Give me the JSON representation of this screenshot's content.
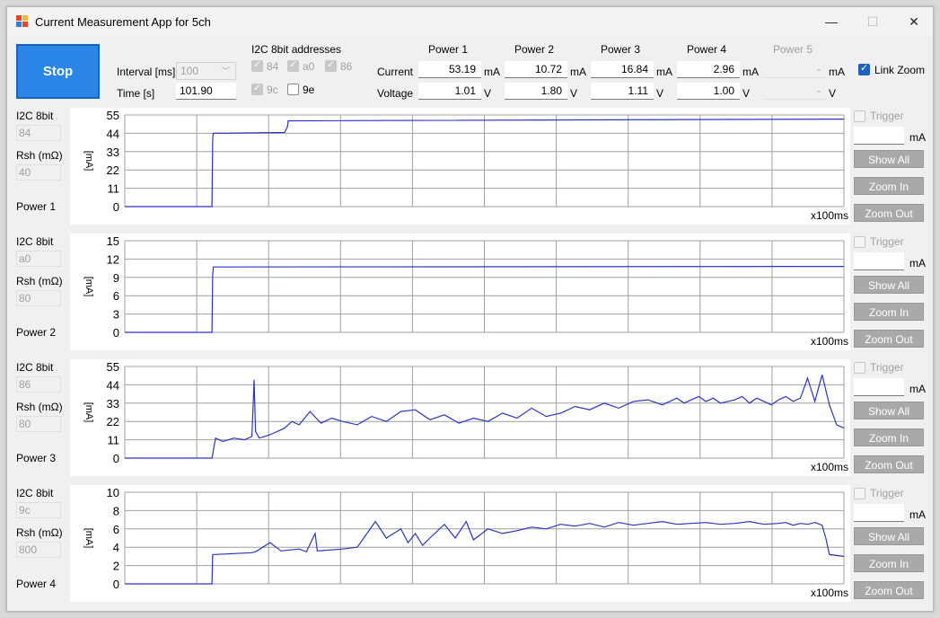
{
  "window": {
    "title": "Current Measurement App for 5ch",
    "minimize": "—",
    "maximize": "☐",
    "close": "✕"
  },
  "controls": {
    "stop_label": "Stop",
    "interval_label": "Interval [ms]",
    "interval_value": "100",
    "time_label": "Time [s]",
    "time_value": "101.90",
    "i2c_header": "I2C 8bit addresses",
    "addresses": [
      {
        "label": "84",
        "checked": true
      },
      {
        "label": "a0",
        "checked": true
      },
      {
        "label": "86",
        "checked": true
      },
      {
        "label": "9c",
        "checked": true
      },
      {
        "label": "9e",
        "checked": false
      }
    ],
    "link_zoom_label": "Link Zoom"
  },
  "readings": {
    "current_label": "Current",
    "voltage_label": "Voltage",
    "current_unit": "mA",
    "voltage_unit": "V",
    "channels": [
      {
        "name": "Power 1",
        "current": "53.19",
        "voltage": "1.01"
      },
      {
        "name": "Power 2",
        "current": "10.72",
        "voltage": "1.80"
      },
      {
        "name": "Power 3",
        "current": "16.84",
        "voltage": "1.11"
      },
      {
        "name": "Power 4",
        "current": "2.96",
        "voltage": "1.00"
      },
      {
        "name": "Power 5",
        "current": "-",
        "voltage": "-"
      }
    ]
  },
  "panel_labels": {
    "i2c": "I2C 8bit",
    "rsh": "Rsh (mΩ)",
    "trigger": "Trigger",
    "trigger_unit": "mA",
    "show_all": "Show All",
    "zoom_in": "Zoom In",
    "zoom_out": "Zoom Out",
    "ylabel": "[mA]",
    "xunit": "x100ms"
  },
  "chart_data": [
    {
      "type": "line",
      "name": "Power 1",
      "i2c": "84",
      "rsh": "40",
      "ylabel": "[mA]",
      "xlabel": "x100ms",
      "ylim": [
        0,
        55
      ],
      "yticks": [
        "55",
        "44",
        "33",
        "22",
        "11",
        "0"
      ],
      "color": "#2b35c4",
      "x": [
        0,
        120,
        121,
        122,
        220,
        224,
        225,
        990
      ],
      "y": [
        0,
        0,
        41,
        44,
        44.5,
        48,
        51.5,
        52.5
      ]
    },
    {
      "type": "line",
      "name": "Power 2",
      "i2c": "a0",
      "rsh": "80",
      "ylabel": "[mA]",
      "xlabel": "x100ms",
      "ylim": [
        0,
        15
      ],
      "yticks": [
        "15",
        "12",
        "9",
        "6",
        "3",
        "0"
      ],
      "color": "#2b35c4",
      "x": [
        0,
        120,
        121,
        122,
        990
      ],
      "y": [
        0,
        0,
        9.5,
        10.7,
        10.8
      ]
    },
    {
      "type": "line",
      "name": "Power 3",
      "i2c": "86",
      "rsh": "80",
      "ylabel": "[mA]",
      "xlabel": "x100ms",
      "ylim": [
        0,
        55
      ],
      "yticks": [
        "55",
        "44",
        "33",
        "22",
        "11",
        "0"
      ],
      "color": "#2b35c4",
      "x": [
        0,
        120,
        125,
        135,
        150,
        165,
        175,
        178,
        180,
        185,
        200,
        220,
        230,
        240,
        255,
        270,
        285,
        300,
        320,
        340,
        360,
        380,
        400,
        420,
        440,
        460,
        480,
        500,
        520,
        540,
        560,
        580,
        600,
        620,
        640,
        660,
        680,
        700,
        720,
        740,
        760,
        770,
        780,
        790,
        800,
        810,
        820,
        830,
        840,
        850,
        860,
        870,
        880,
        890,
        900,
        910,
        920,
        930,
        940,
        950,
        960,
        970,
        980,
        990
      ],
      "y": [
        0,
        0,
        12,
        10,
        12,
        11,
        13,
        47,
        16,
        12,
        14,
        18,
        22,
        20,
        28,
        21,
        24,
        22,
        20,
        25,
        22,
        28,
        29,
        23,
        26,
        21,
        24,
        22,
        27,
        24,
        30,
        25,
        27,
        31,
        29,
        33,
        30,
        34,
        35,
        32,
        36,
        33,
        35,
        37,
        34,
        36,
        33,
        34,
        35,
        37,
        33,
        36,
        34,
        32,
        35,
        37,
        34,
        36,
        48,
        34,
        50,
        32,
        20,
        18
      ]
    },
    {
      "type": "line",
      "name": "Power 4",
      "i2c": "9c",
      "rsh": "800",
      "ylabel": "[mA]",
      "xlabel": "x100ms",
      "ylim": [
        0,
        10
      ],
      "yticks": [
        "10",
        "8",
        "6",
        "4",
        "2",
        "0"
      ],
      "color": "#2b35c4",
      "x": [
        0,
        120,
        121,
        150,
        175,
        180,
        200,
        215,
        240,
        250,
        262,
        265,
        300,
        320,
        345,
        360,
        380,
        390,
        400,
        410,
        420,
        440,
        455,
        470,
        480,
        500,
        520,
        540,
        560,
        580,
        600,
        620,
        640,
        660,
        680,
        700,
        720,
        740,
        760,
        780,
        800,
        820,
        840,
        860,
        880,
        900,
        910,
        920,
        930,
        940,
        950,
        960,
        965,
        970,
        990
      ],
      "y": [
        0,
        0,
        3.2,
        3.3,
        3.4,
        3.5,
        4.5,
        3.6,
        3.8,
        3.5,
        5.5,
        3.6,
        3.8,
        4.0,
        6.8,
        5.0,
        6.0,
        4.5,
        5.5,
        4.2,
        5.0,
        6.5,
        5.0,
        6.8,
        4.8,
        6.0,
        5.5,
        5.8,
        6.2,
        6.0,
        6.5,
        6.3,
        6.6,
        6.2,
        6.7,
        6.4,
        6.6,
        6.8,
        6.5,
        6.6,
        6.7,
        6.5,
        6.6,
        6.8,
        6.5,
        6.6,
        6.7,
        6.4,
        6.6,
        6.5,
        6.7,
        6.4,
        5.0,
        3.2,
        3.0
      ]
    }
  ]
}
